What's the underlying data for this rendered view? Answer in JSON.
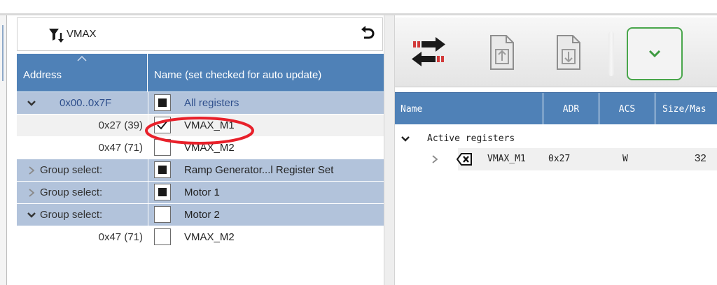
{
  "filter": {
    "label": "VMAX"
  },
  "left_table": {
    "columns": [
      "Address",
      "Name (set checked for auto update)"
    ],
    "rows": [
      {
        "address": "0x00..0x7F",
        "name": "All registers",
        "check": "filled",
        "expander": "expanded"
      },
      {
        "address": "0x27 (39)",
        "name": "VMAX_M1",
        "check": "checked",
        "expander": ""
      },
      {
        "address": "0x47 (71)",
        "name": "VMAX_M2",
        "check": "empty",
        "expander": ""
      },
      {
        "address": "Group select:",
        "name": "Ramp Generator...l Register Set",
        "check": "filled",
        "expander": "collapsed"
      },
      {
        "address": "Group select:",
        "name": "Motor 1",
        "check": "filled",
        "expander": "collapsed"
      },
      {
        "address": "Group select:",
        "name": "Motor 2",
        "check": "empty",
        "expander": "expanded"
      },
      {
        "address": "0x47 (71)",
        "name": "VMAX_M2",
        "check": "empty",
        "expander": ""
      }
    ]
  },
  "toolbar": {
    "icons": [
      "swap-arrows-icon",
      "upload-document-icon",
      "download-document-icon",
      "checkmark-chevron-icon"
    ]
  },
  "right_table": {
    "columns": [
      "Name",
      "ADR",
      "ACS",
      "Size/Mas"
    ],
    "group_label": "Active registers",
    "register": {
      "name": "VMAX_M1",
      "adr": "0x27",
      "acs": "W",
      "size": "32"
    }
  },
  "colors": {
    "header_blue": "#4f81b7",
    "row_group": "#b2c3db",
    "accent_green": "#49a64b",
    "annotation_red": "#e8202a"
  }
}
